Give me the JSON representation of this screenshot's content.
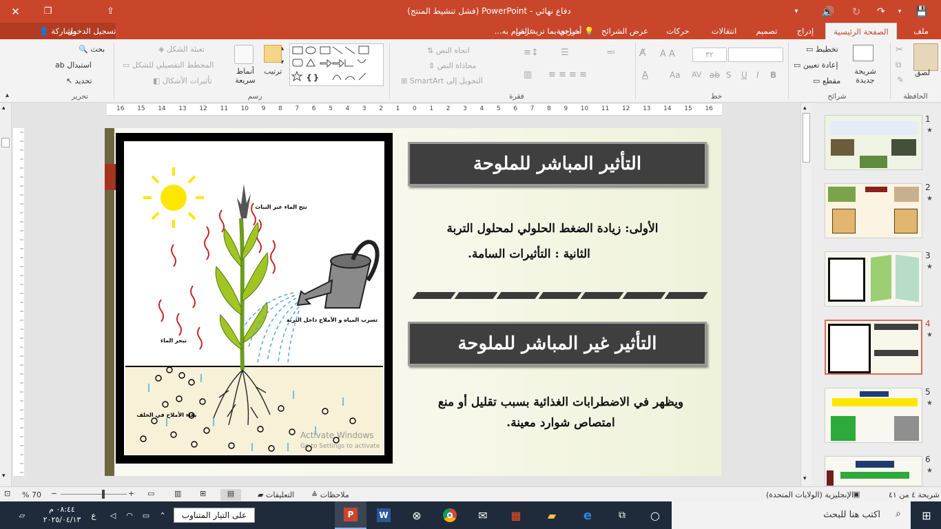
{
  "window": {
    "title": "دفاع نهائي - PowerPoint (فشل تنشيط المنتج)",
    "controls": {
      "close": "✕",
      "restore": "❐",
      "minimize": "—"
    }
  },
  "qat": {
    "save": "💾",
    "undo": "↶",
    "redo": "↷",
    "more": "▾"
  },
  "tabs": {
    "file": "ملف",
    "home": "الصفحة الرئيسية",
    "insert": "إدراج",
    "design": "تصميم",
    "transitions": "انتقالات",
    "animations": "حركات",
    "slideshow": "عرض الشرائح",
    "review": "مراجعة",
    "view": "عرض",
    "tellme": "أخبرني بما تريد القيام به...",
    "signin": "تسجيل الدخول",
    "share": "مشاركة"
  },
  "ribbon": {
    "clipboard": {
      "paste": "لصق",
      "group": "الحافظة"
    },
    "slides": {
      "new_slide": "شريحة جديدة",
      "layout": "تخطيط",
      "reset": "إعادة تعيين",
      "section": "مقطع",
      "group": "شرائح"
    },
    "font": {
      "size": "٣٢",
      "group": "خط"
    },
    "paragraph": {
      "text_direction": "اتجاه النص",
      "align_text": "محاذاة النص",
      "smartart": "التحويل إلى SmartArt",
      "group": "فقرة"
    },
    "drawing": {
      "arrange": "ترتيب",
      "quick_styles": "أنماط سريعة",
      "fill": "تعبئة الشكل",
      "outline": "المخطط التفصيلي للشكل",
      "effects": "تأثيرات الأشكال",
      "group": "رسم"
    },
    "editing": {
      "find": "بحث",
      "replace": "استبدال",
      "select": "تحديد",
      "group": "تحرير"
    }
  },
  "ruler": {
    "ticks": [
      "16",
      "15",
      "14",
      "13",
      "12",
      "11",
      "10",
      "9",
      "8",
      "7",
      "6",
      "5",
      "4",
      "3",
      "2",
      "1",
      "0",
      "1",
      "2",
      "3",
      "4",
      "5",
      "6",
      "7",
      "8",
      "9",
      "10",
      "11",
      "12",
      "13",
      "14",
      "15",
      "16"
    ]
  },
  "slide": {
    "heading1": "التأثير المباشر للملوحة",
    "line1": "الأولى: زيادة الضغط الحلولي لمحلول التربة",
    "line2": "الثانية : التأثيرات السامة.",
    "heading2": "التأثير غير المباشر للملوحة",
    "para": "ويظهر في الاضطرابات الغذائية بسبب تقليل أو منع امتصاص شوارد معينة.",
    "diagram": {
      "transpiration": "نتح الماء عبر النبات",
      "uptake": "تسرب المياه و الأملاح داخل التربة",
      "evaporation": "تبخر الماء",
      "salts": "بقاء الأملاح في الخلف"
    },
    "watermark1": "Activate Windows",
    "watermark2": "Go to Settings to activate Windows."
  },
  "thumbnails": [
    {
      "num": "1",
      "star": "★"
    },
    {
      "num": "2",
      "star": "★"
    },
    {
      "num": "3",
      "star": "★"
    },
    {
      "num": "4",
      "star": "★"
    },
    {
      "num": "5",
      "star": "★"
    },
    {
      "num": "6",
      "star": "★"
    }
  ],
  "status": {
    "slide_count": "شريحة ٤ من ٤١",
    "language": "الإنجليزية (الولايات المتحدة)",
    "notes": "ملاحظات",
    "comments": "التعليقات",
    "zoom": "70 %"
  },
  "taskbar": {
    "search_placeholder": "اكتب هنا للبحث",
    "time": "٠٨:٤٤ م",
    "date": "٢٠٢٥/٠٤/١٣",
    "notification": "على التيار المتناوب",
    "lang": "ع"
  },
  "colors": {
    "accent": "#c9462b",
    "banner": "#3f3f3f"
  }
}
